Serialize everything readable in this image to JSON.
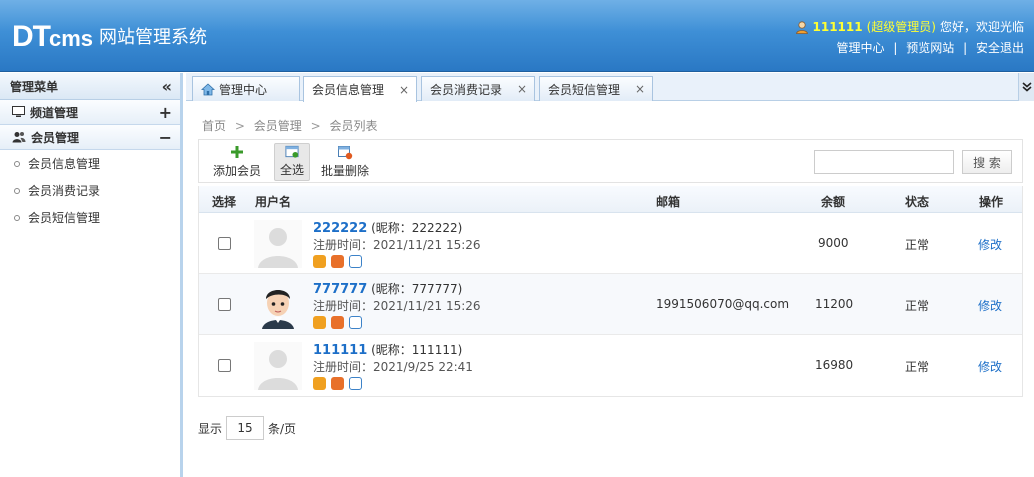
{
  "header": {
    "logo_dt": "DT",
    "logo_cms": "cms",
    "system_name": "网站管理系统",
    "user_name": "111111",
    "user_role": "(超级管理员)",
    "greeting": "您好，欢迎光临",
    "links": [
      "管理中心",
      "预览网站",
      "安全退出"
    ],
    "link_separator": "|"
  },
  "sidebar": {
    "title": "管理菜单",
    "collapse_glyph": "«",
    "groups": [
      {
        "label": "频道管理",
        "toggle": "+"
      },
      {
        "label": "会员管理",
        "toggle": "−"
      }
    ],
    "items": [
      "会员信息管理",
      "会员消费记录",
      "会员短信管理"
    ]
  },
  "tabs": [
    {
      "label": "管理中心"
    },
    {
      "label": "会员信息管理",
      "close": "×"
    },
    {
      "label": "会员消费记录",
      "close": "×"
    },
    {
      "label": "会员短信管理",
      "close": "×"
    }
  ],
  "breadcrumb": [
    "首页",
    "会员管理",
    "会员列表"
  ],
  "breadcrumb_separator": ">",
  "toolbar": {
    "add_label": "添加会员",
    "select_all_label": "全选",
    "batch_delete_label": "批量删除",
    "search_label": "搜 索",
    "search_value": ""
  },
  "table": {
    "headers": {
      "select": "选择",
      "username": "用户名",
      "email": "邮箱",
      "balance": "余额",
      "status": "状态",
      "action": "操作"
    },
    "rows": [
      {
        "id": "222222",
        "nick": "(昵称：222222)",
        "reg": "注册时间：2021/11/21 15:26",
        "email": "",
        "balance": "9000",
        "status": "正常",
        "action": "修改",
        "avatar": "default"
      },
      {
        "id": "777777",
        "nick": "(昵称：777777)",
        "reg": "注册时间：2021/11/21 15:26",
        "email": "1991506070@qq.com",
        "balance": "11200",
        "status": "正常",
        "action": "修改",
        "avatar": "cartoon"
      },
      {
        "id": "111111",
        "nick": "(昵称：111111)",
        "reg": "注册时间：2021/9/25 22:41",
        "email": "",
        "balance": "16980",
        "status": "正常",
        "action": "修改",
        "avatar": "default"
      }
    ]
  },
  "pager": {
    "prefix": "显示",
    "page_size": "15",
    "suffix": "条/页"
  }
}
